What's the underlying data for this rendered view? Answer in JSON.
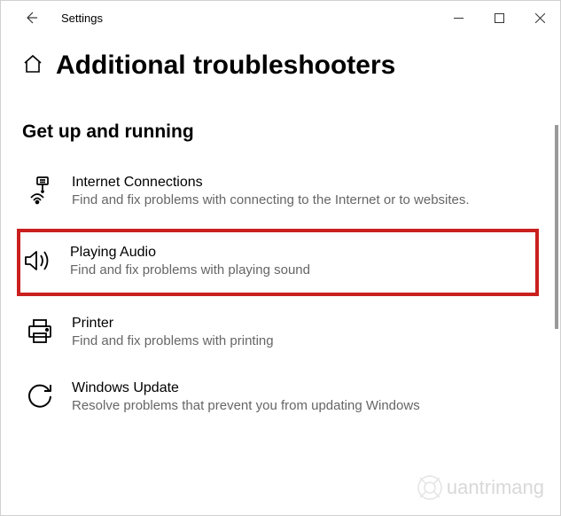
{
  "titlebar": {
    "app_name": "Settings"
  },
  "page": {
    "title": "Additional troubleshooters"
  },
  "section": {
    "heading": "Get up and running"
  },
  "items": [
    {
      "icon": "network-icon",
      "title": "Internet Connections",
      "desc": "Find and fix problems with connecting to the Internet or to websites.",
      "highlighted": false
    },
    {
      "icon": "audio-icon",
      "title": "Playing Audio",
      "desc": "Find and fix problems with playing sound",
      "highlighted": true
    },
    {
      "icon": "printer-icon",
      "title": "Printer",
      "desc": "Find and fix problems with printing",
      "highlighted": false
    },
    {
      "icon": "update-icon",
      "title": "Windows Update",
      "desc": "Resolve problems that prevent you from updating Windows",
      "highlighted": false
    }
  ],
  "watermark": {
    "text": "uantrimang"
  }
}
